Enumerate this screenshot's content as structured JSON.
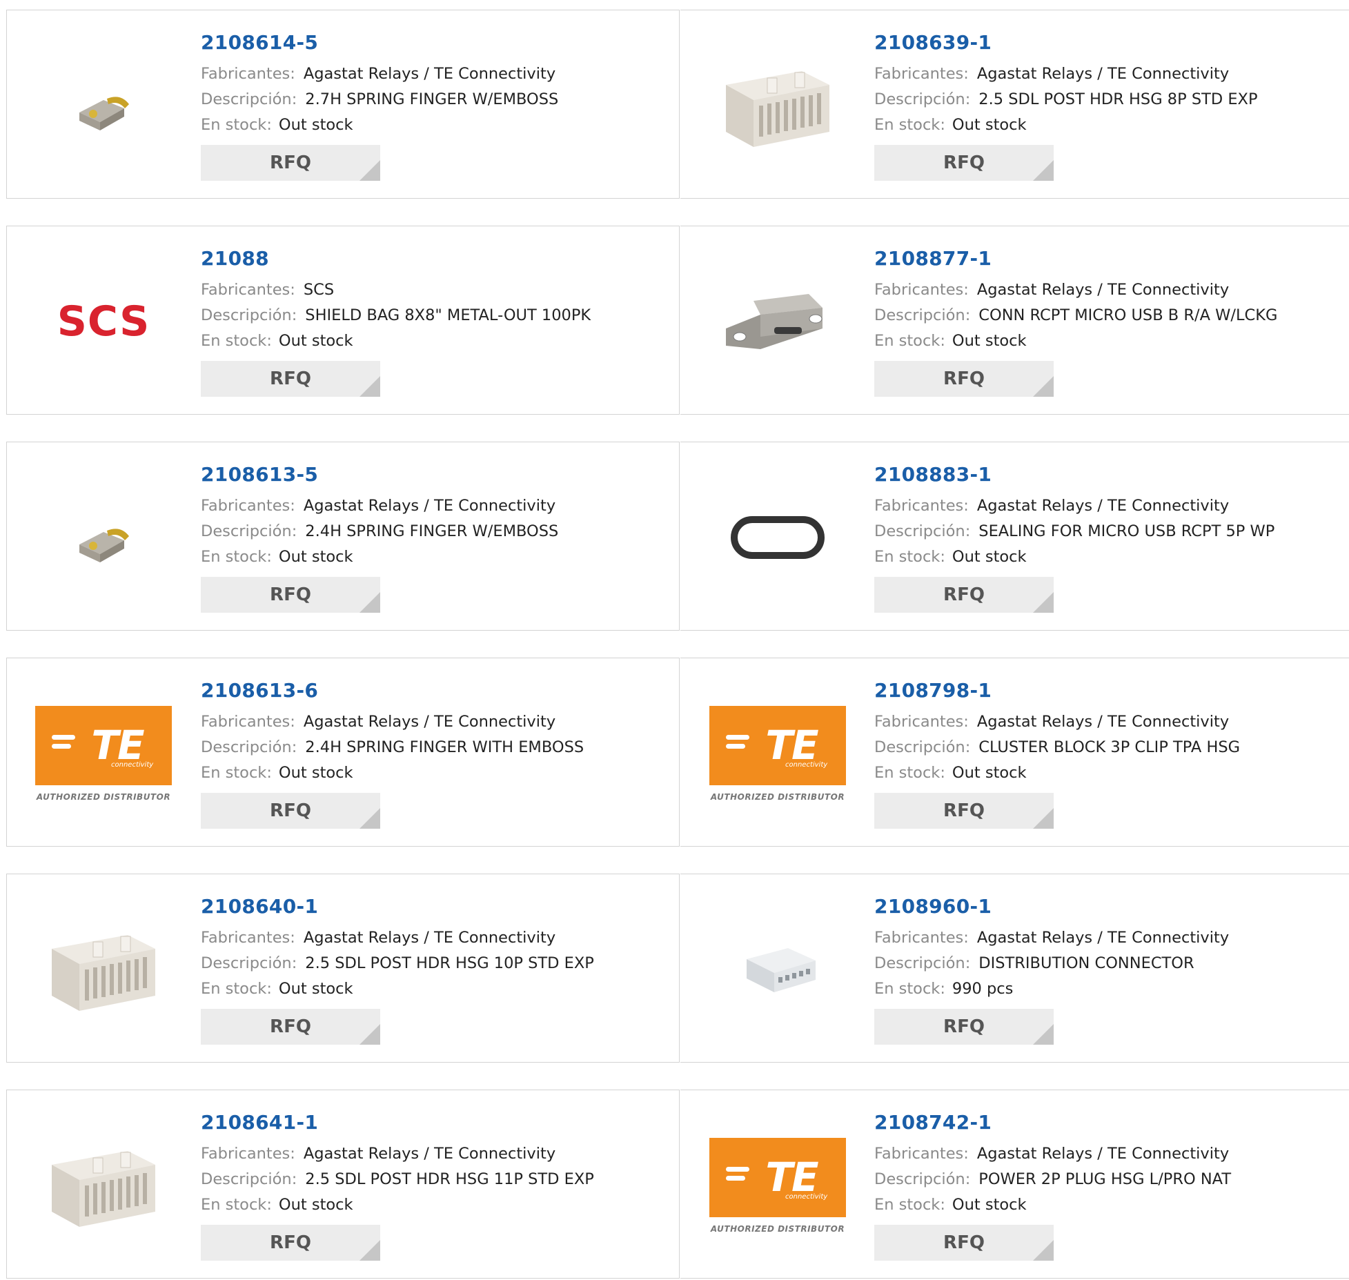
{
  "labels": {
    "manufacturer": "Fabricantes:",
    "description": "Descripción:",
    "stock": "En stock:",
    "rfq": "RFQ"
  },
  "brand": {
    "scs_logo_text": "SCS",
    "te_logo_text": "TE",
    "te_logo_sub": "connectivity",
    "te_authorized": "AUTHORIZED DISTRIBUTOR"
  },
  "colors": {
    "link": "#1a5ea8",
    "scs_red": "#d9232e",
    "te_orange": "#f28c1d"
  },
  "products": [
    {
      "part": "2108614-5",
      "manufacturer": "Agastat Relays / TE Connectivity",
      "description": "2.7H SPRING FINGER W/EMBOSS",
      "stock": "Out stock",
      "image": "spring-finger-icon"
    },
    {
      "part": "2108639-1",
      "manufacturer": "Agastat Relays / TE Connectivity",
      "description": "2.5 SDL POST HDR HSG 8P STD EXP",
      "stock": "Out stock",
      "image": "connector-housing-icon"
    },
    {
      "part": "21088",
      "manufacturer": "SCS",
      "description": "SHIELD BAG 8X8\" METAL-OUT 100PK",
      "stock": "Out stock",
      "image": "scs-logo"
    },
    {
      "part": "2108877-1",
      "manufacturer": "Agastat Relays / TE Connectivity",
      "description": "CONN RCPT MICRO USB B R/A W/LCKG",
      "stock": "Out stock",
      "image": "micro-usb-icon"
    },
    {
      "part": "2108613-5",
      "manufacturer": "Agastat Relays / TE Connectivity",
      "description": "2.4H SPRING FINGER W/EMBOSS",
      "stock": "Out stock",
      "image": "spring-finger-icon"
    },
    {
      "part": "2108883-1",
      "manufacturer": "Agastat Relays / TE Connectivity",
      "description": "SEALING FOR MICRO USB RCPT 5P WP",
      "stock": "Out stock",
      "image": "seal-ring-icon"
    },
    {
      "part": "2108613-6",
      "manufacturer": "Agastat Relays / TE Connectivity",
      "description": "2.4H SPRING FINGER WITH EMBOSS",
      "stock": "Out stock",
      "image": "te-logo"
    },
    {
      "part": "2108798-1",
      "manufacturer": "Agastat Relays / TE Connectivity",
      "description": "CLUSTER BLOCK 3P CLIP TPA HSG",
      "stock": "Out stock",
      "image": "te-logo"
    },
    {
      "part": "2108640-1",
      "manufacturer": "Agastat Relays / TE Connectivity",
      "description": "2.5 SDL POST HDR HSG 10P STD EXP",
      "stock": "Out stock",
      "image": "connector-housing-icon"
    },
    {
      "part": "2108960-1",
      "manufacturer": "Agastat Relays / TE Connectivity",
      "description": "DISTRIBUTION CONNECTOR",
      "stock": "990 pcs",
      "image": "distribution-connector-icon"
    },
    {
      "part": "2108641-1",
      "manufacturer": "Agastat Relays / TE Connectivity",
      "description": "2.5 SDL POST HDR HSG 11P STD EXP",
      "stock": "Out stock",
      "image": "connector-housing-icon"
    },
    {
      "part": "2108742-1",
      "manufacturer": "Agastat Relays / TE Connectivity",
      "description": "POWER 2P PLUG HSG L/PRO NAT",
      "stock": "Out stock",
      "image": "te-logo"
    }
  ]
}
